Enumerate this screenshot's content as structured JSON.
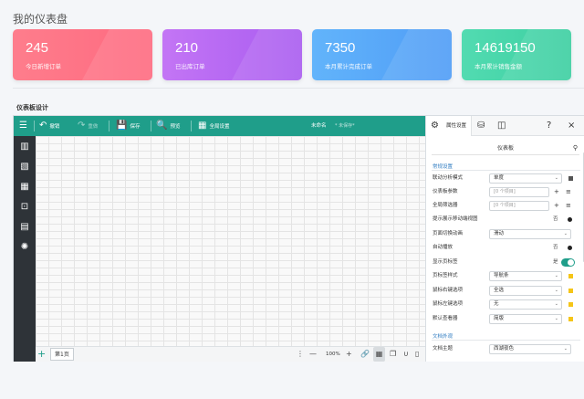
{
  "dashboard": {
    "title": "我的仪表盘",
    "cards": [
      {
        "value": "245",
        "label": "今日新增订单",
        "color": "#fe6a80"
      },
      {
        "value": "210",
        "label": "已出库订单",
        "color": "#a95cf0"
      },
      {
        "value": "7350",
        "label": "本月累计完成订单",
        "color": "#4f9cf6"
      },
      {
        "value": "14619150",
        "label": "本月累计销售金额",
        "color": "#3ccfa1"
      }
    ]
  },
  "designer": {
    "section_title": "仪表板设计",
    "accent": "#1f9e8a",
    "toolbar": {
      "undo": "撤销",
      "redo": "重做",
      "save": "保存",
      "preview": "预览",
      "global_settings": "全局设置",
      "doc_name": "未命名",
      "doc_status": "* 未保存*"
    },
    "bottom": {
      "page_tab": "第1页",
      "zoom": "100%"
    },
    "panel": {
      "tab_properties": "属性设置",
      "search_value": "仪表板",
      "group_common": "常规设置",
      "rows": {
        "linkage_mode_label": "联动分析模式",
        "linkage_mode_value": "单度",
        "dashboard_params_label": "仪表板参数",
        "dashboard_params_value": "[0 个项目]",
        "global_filter_label": "全局筛选器",
        "global_filter_value": "[0 个项目]",
        "mobile_flow_label": "提示展示移动端视图",
        "mobile_flow_tag": "否",
        "page_anim_label": "页面切换动画",
        "page_anim_value": "滑动",
        "autoplay_label": "自动播放",
        "autoplay_tag": "否",
        "show_page_tab_label": "显示页标签",
        "show_page_tab_tag": "是",
        "page_tab_style_label": "页标签样式",
        "page_tab_style_value": "导航条",
        "right_click_label": "鼠标右键选项",
        "right_click_value": "全选",
        "left_click_label": "鼠标左键选项",
        "left_click_value": "无",
        "default_viewer_label": "默认查看器",
        "default_viewer_value": "简版"
      },
      "group_docs": "文档外观",
      "theme_label": "文档主题",
      "theme_value": "西湖夜色"
    }
  }
}
